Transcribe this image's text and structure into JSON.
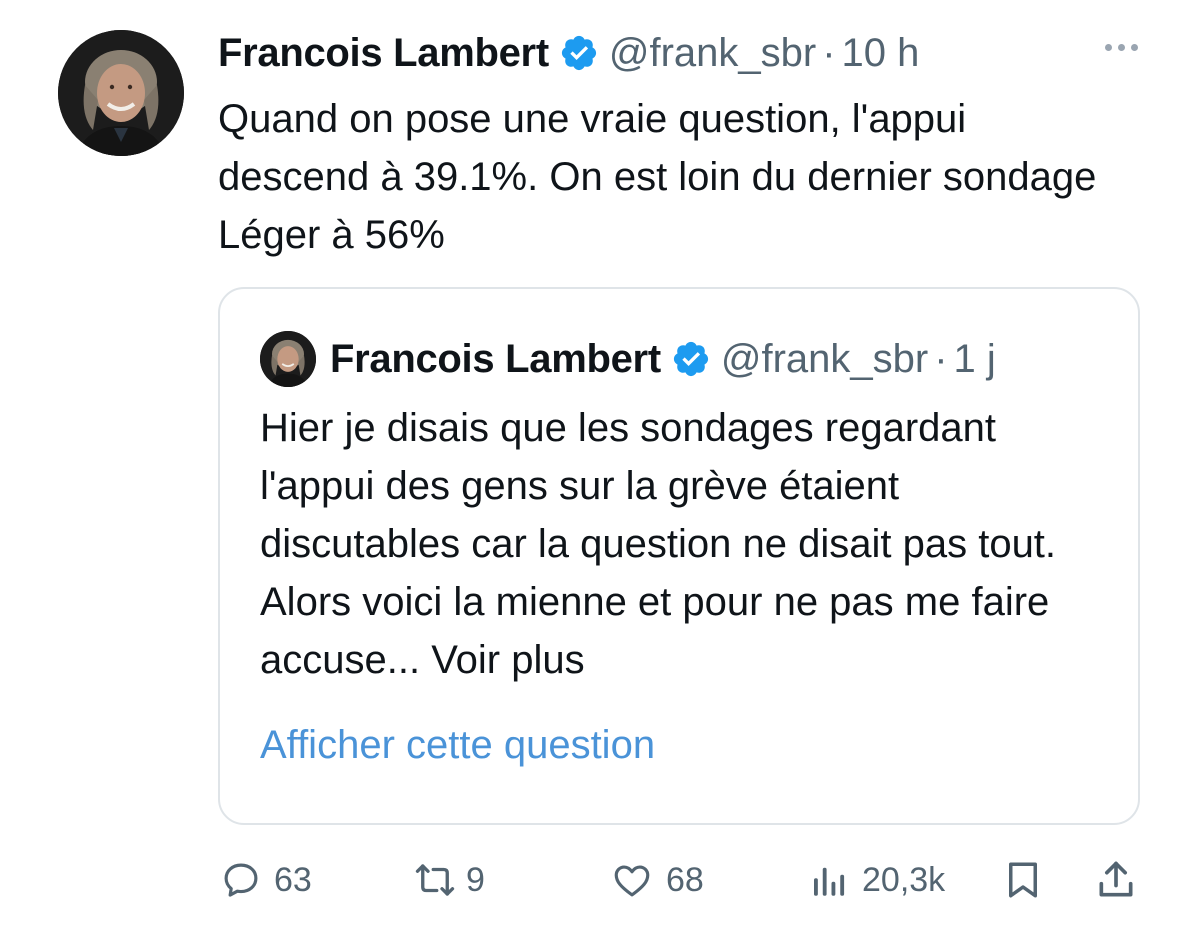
{
  "tweet": {
    "author_name": "Francois Lambert",
    "handle": "@frank_sbr",
    "separator": "·",
    "time": "10 h",
    "text": "Quand on pose une vraie question, l'appui descend à 39.1%. On est loin du dernier sondage Léger à 56%",
    "verified_color": "#1d9bf0"
  },
  "quoted_tweet": {
    "author_name": "Francois Lambert",
    "handle": "@frank_sbr",
    "separator": "·",
    "time": "1 j",
    "text": "Hier je disais que les sondages regardant l'appui des gens sur la grève étaient discutables car la question ne disait pas tout. Alors voici la mienne et pour ne pas me faire accuse... Voir plus",
    "link_label": "Afficher cette question",
    "link_color": "#4a93d8"
  },
  "actions": {
    "replies": "63",
    "retweets": "9",
    "likes": "68",
    "views": "20,3k"
  },
  "icons": {
    "reply": "reply-bubble-icon",
    "retweet": "retweet-icon",
    "like": "heart-icon",
    "views": "bar-chart-icon",
    "bookmark": "bookmark-icon",
    "share": "share-upload-icon",
    "more": "more-dots-icon",
    "verified": "verified-badge-icon"
  }
}
